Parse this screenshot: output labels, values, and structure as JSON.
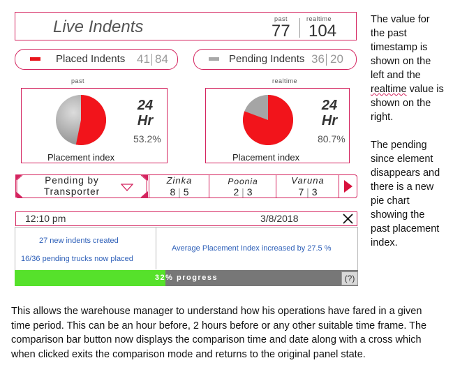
{
  "header": {
    "title": "Live Indents",
    "past_label": "past",
    "past_value": "77",
    "realtime_label": "realtime",
    "realtime_value": "104"
  },
  "placed": {
    "label": "Placed Indents",
    "past": "41",
    "realtime": "84",
    "color": "#e8141b"
  },
  "pending": {
    "label": "Pending Indents",
    "past": "36",
    "realtime": "20",
    "color": "#a8a8a8"
  },
  "panels": [
    {
      "caption": "past",
      "hr_line1": "24",
      "hr_line2": "Hr",
      "percent": "53.2%",
      "percent_value": 53.2,
      "label": "Placement index"
    },
    {
      "caption": "realtime",
      "hr_line1": "24",
      "hr_line2": "Hr",
      "percent": "80.7%",
      "percent_value": 80.7,
      "label": "Placement index"
    }
  ],
  "transporter": {
    "dropdown_line1": "Pending by",
    "dropdown_line2": "Transporter",
    "items": [
      {
        "name": "Zinka",
        "a": "8",
        "b": "5"
      },
      {
        "name": "Poonia",
        "a": "2",
        "b": "3"
      },
      {
        "name": "Varuna",
        "a": "7",
        "b": "3"
      }
    ]
  },
  "comparison": {
    "time": "12:10 pm",
    "date": "3/8/2018"
  },
  "notifications": {
    "line1": "27 new indents created",
    "line2": "16/36  pending trucks now placed",
    "right": "Average Placement Index increased by 27.5 %"
  },
  "progress": {
    "label": "32% progress",
    "value": 0.44,
    "help": "(?)"
  },
  "side_note": {
    "p1_lines": [
      "The value for",
      "the past",
      "timestamp is",
      "shown on the",
      "left and the",
      "realtime value is",
      "shown on the",
      "right."
    ],
    "p2_lines": [
      "The pending",
      "since element",
      "disappears and",
      "there is a new",
      "pie chart",
      "showing the",
      "past placement",
      "index."
    ]
  },
  "bottom_lines": [
    "This allows the warehouse manager to understand how his operations have fared in a given",
    "time period. This can be an hour before, 2 hours before or any other suitable time frame. The",
    "comparison bar button now displays the comparison time and date along with a cross which",
    "when clicked exits the comparison mode and returns to the original panel state."
  ]
}
